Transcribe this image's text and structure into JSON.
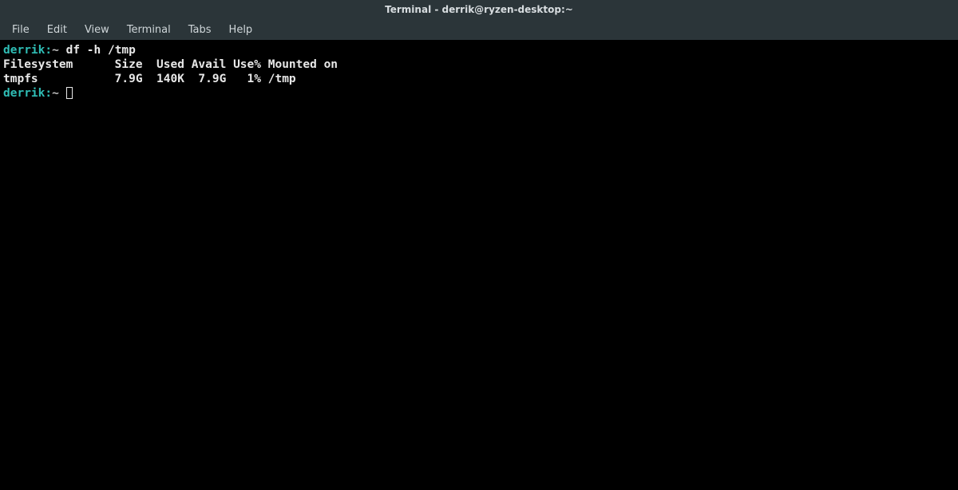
{
  "window": {
    "title": "Terminal - derrik@ryzen-desktop:~"
  },
  "menubar": {
    "items": [
      {
        "label": "File"
      },
      {
        "label": "Edit"
      },
      {
        "label": "View"
      },
      {
        "label": "Terminal"
      },
      {
        "label": "Tabs"
      },
      {
        "label": "Help"
      }
    ]
  },
  "terminal": {
    "prompt1_user": "derrik",
    "prompt1_sep": ":",
    "prompt1_path": "~",
    "prompt1_cmd": " df -h /tmp",
    "header_line": "Filesystem      Size  Used Avail Use% Mounted on",
    "data_line": "tmpfs           7.9G  140K  7.9G   1% /tmp",
    "prompt2_user": "derrik",
    "prompt2_sep": ":",
    "prompt2_path": "~"
  }
}
